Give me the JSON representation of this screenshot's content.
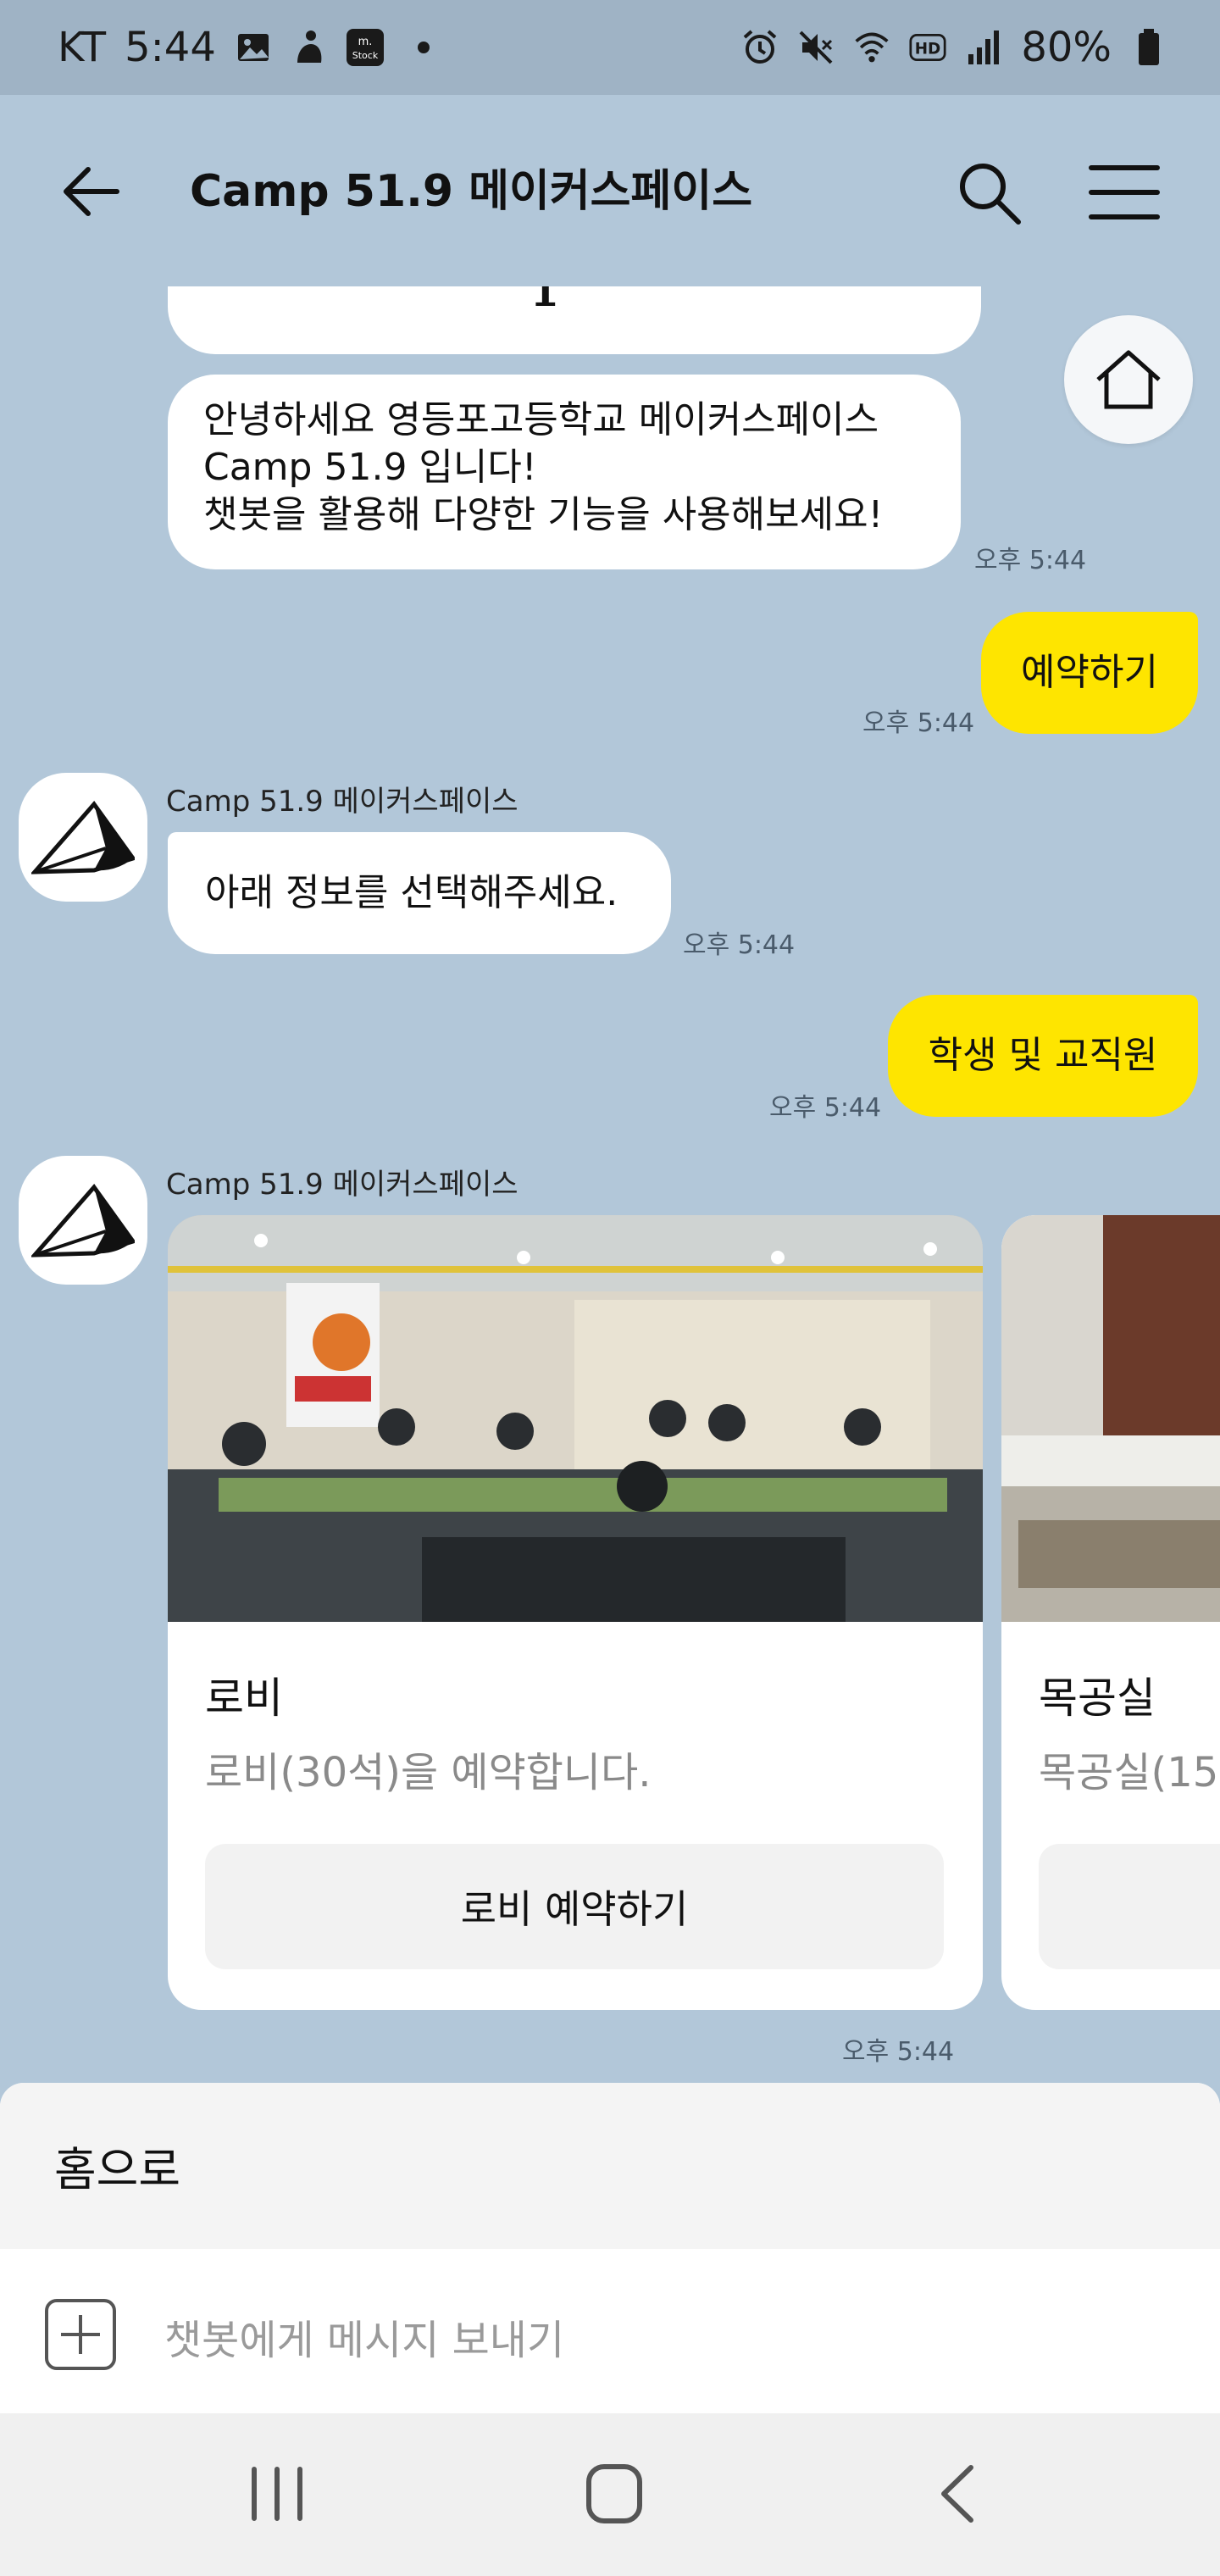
{
  "status_bar": {
    "carrier": "KT",
    "time": "5:44",
    "battery": "80%",
    "notification_icons": [
      "image-icon",
      "app-icon",
      "mstock-icon"
    ],
    "mstock_label": "m.\nStock",
    "system_icons": [
      "alarm-icon",
      "mute-icon",
      "wifi-icon",
      "hd-icon",
      "signal-icon",
      "battery-icon"
    ]
  },
  "header": {
    "title": "Camp 51.9 메이커스페이스"
  },
  "chat": {
    "top_bubble_partial_char": "I",
    "welcome_lines": [
      "안녕하세요 영등포고등학교 메이커스페이스",
      "Camp 51.9 입니다!",
      "챗봇을 활용해 다양한 기능을 사용해보세요!"
    ],
    "welcome_time": "오후 5:44",
    "user_msg_1": "예약하기",
    "user_msg_1_time": "오후 5:44",
    "bot_name_1": "Camp 51.9 메이커스페이스",
    "bot_msg_2": "아래 정보를 선택해주세요.",
    "bot_msg_2_time": "오후 5:44",
    "user_msg_2": "학생 및 교직원",
    "user_msg_2_time": "오후 5:44",
    "bot_name_2": "Camp 51.9 메이커스페이스",
    "cards": [
      {
        "title": "로비",
        "desc": "로비(30석)을 예약합니다.",
        "button": "로비 예약하기"
      },
      {
        "title": "목공실",
        "desc": "목공실(15",
        "button": ""
      }
    ],
    "cards_time": "오후 5:44"
  },
  "bottom": {
    "quick_reply": "홈으로",
    "input_placeholder": "챗봇에게 메시지 보내기"
  },
  "colors": {
    "chat_bg": "#b2c7d9",
    "status_bg": "#9fb3c5",
    "user_bubble": "#fee500",
    "bot_bubble": "#ffffff"
  }
}
